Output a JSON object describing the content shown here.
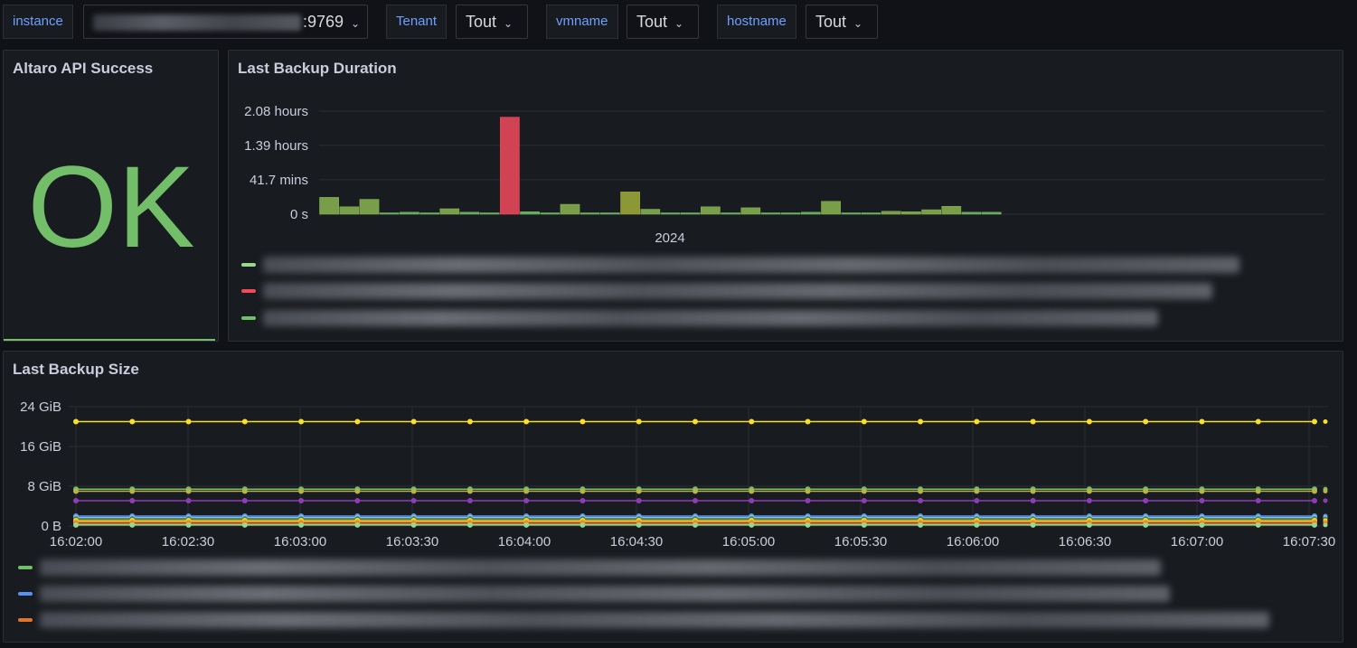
{
  "variables": [
    {
      "label": "instance",
      "value": ":9769"
    },
    {
      "label": "Tenant",
      "value": "Tout"
    },
    {
      "label": "vmname",
      "value": "Tout"
    },
    {
      "label": "hostname",
      "value": "Tout"
    }
  ],
  "panels": {
    "api": {
      "title": "Altaro API Success",
      "value": "OK",
      "color": "#73bf69"
    },
    "duration": {
      "title": "Last Backup Duration"
    },
    "size": {
      "title": "Last Backup Size"
    }
  },
  "chart_data": [
    {
      "type": "bar",
      "title": "Last Backup Duration",
      "ylabel": "",
      "xlabel": "2024",
      "yticks": [
        "0 s",
        "41.7 mins",
        "1.39 hours",
        "2.08 hours"
      ],
      "ytick_values_hours": [
        0,
        0.695,
        1.39,
        2.08
      ],
      "ylim_hours": [
        0,
        2.08
      ],
      "values_hours": [
        0.34,
        0.15,
        0.3,
        0.02,
        0.04,
        0.02,
        0.11,
        0.04,
        0.02,
        1.96,
        0.05,
        0.02,
        0.2,
        0.02,
        0.02,
        0.45,
        0.1,
        0.02,
        0.02,
        0.15,
        0.02,
        0.13,
        0.02,
        0.02,
        0.04,
        0.26,
        0.02,
        0.02,
        0.06,
        0.05,
        0.09,
        0.16,
        0.04,
        0.04
      ],
      "bar_colors": [
        "#8ab552",
        "#8ab552",
        "#8ab552",
        "#73bf69",
        "#73bf69",
        "#73bf69",
        "#8ab552",
        "#73bf69",
        "#73bf69",
        "#f2495c",
        "#73bf69",
        "#73bf69",
        "#8ab552",
        "#73bf69",
        "#73bf69",
        "#a1ad3a",
        "#8ab552",
        "#73bf69",
        "#73bf69",
        "#8ab552",
        "#73bf69",
        "#8ab552",
        "#73bf69",
        "#73bf69",
        "#73bf69",
        "#8ab552",
        "#73bf69",
        "#73bf69",
        "#8ab552",
        "#8ab552",
        "#8ab552",
        "#8ab552",
        "#73bf69",
        "#73bf69"
      ],
      "legend_colors": [
        "#96d98d",
        "#f2495c",
        "#73bf69"
      ]
    },
    {
      "type": "line",
      "title": "Last Backup Size",
      "yticks": [
        "0 B",
        "8 GiB",
        "16 GiB",
        "24 GiB"
      ],
      "ytick_values_gib": [
        0,
        8,
        16,
        24
      ],
      "ylim_gib": [
        0,
        24
      ],
      "xticks": [
        "16:02:00",
        "16:02:30",
        "16:03:00",
        "16:03:30",
        "16:04:00",
        "16:04:30",
        "16:05:00",
        "16:05:30",
        "16:06:00",
        "16:06:30",
        "16:07:00",
        "16:07:30"
      ],
      "points_per_series": 23,
      "series": [
        {
          "color": "#fade2a",
          "value_gib": 21.0
        },
        {
          "color": "#73bf69",
          "value_gib": 7.4
        },
        {
          "color": "#b8b34a",
          "value_gib": 7.0
        },
        {
          "color": "#8f3bb8",
          "value_gib": 5.1
        },
        {
          "color": "#5794f2",
          "value_gib": 2.0
        },
        {
          "color": "#8ab8ff",
          "value_gib": 1.7
        },
        {
          "color": "#37872d",
          "value_gib": 1.4
        },
        {
          "color": "#fade2a",
          "value_gib": 1.1
        },
        {
          "color": "#ff9830",
          "value_gib": 0.8
        },
        {
          "color": "#e0752d",
          "value_gib": 0.4
        },
        {
          "color": "#96d98d",
          "value_gib": 0.2
        }
      ],
      "legend_colors": [
        "#73bf69",
        "#5794f2",
        "#e0752d"
      ]
    }
  ]
}
